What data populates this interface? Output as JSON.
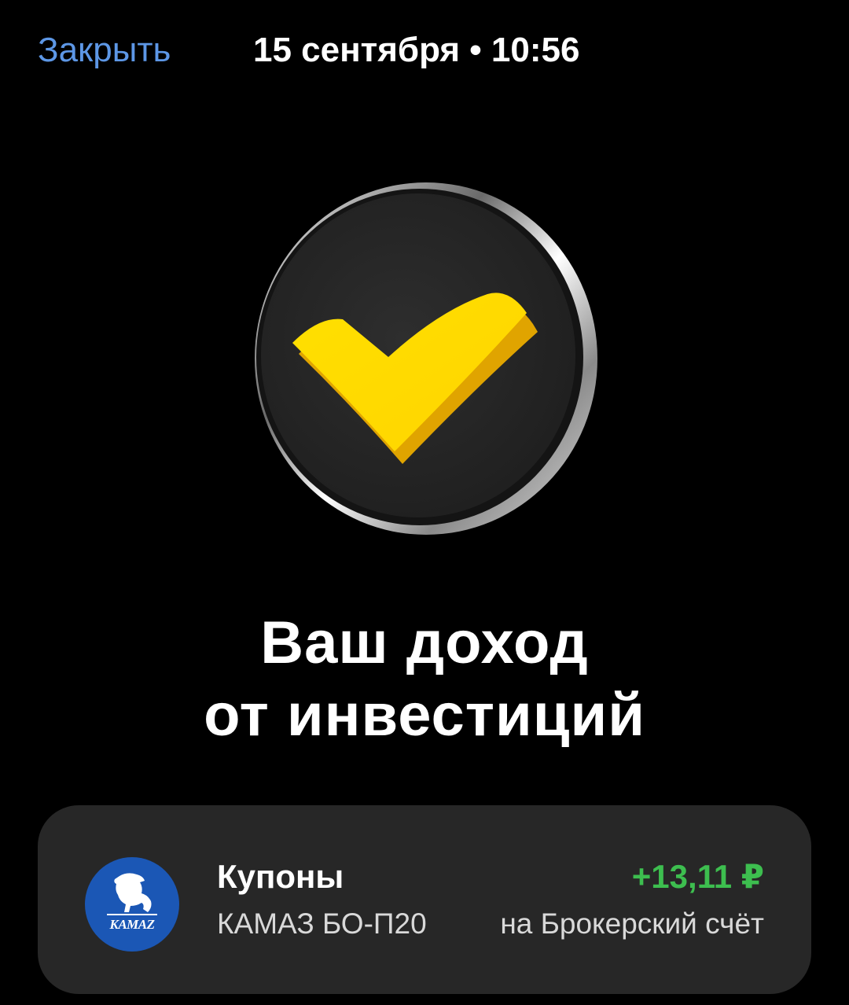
{
  "header": {
    "close_label": "Закрыть",
    "datetime": "15 сентября • 10:56"
  },
  "badge": {
    "icon": "checkmark-icon",
    "accent": "#ffdd2d"
  },
  "headline": {
    "line1": "Ваш доход",
    "line2": "от инвестиций"
  },
  "operation": {
    "logo_text": "KAMAZ",
    "logo_color": "#1b57b5",
    "title": "Купоны",
    "instrument": "КАМАЗ БО-П20",
    "amount": "+13,11 ₽",
    "amount_color": "#3dbe4f",
    "account": "на Брокерский счёт"
  }
}
